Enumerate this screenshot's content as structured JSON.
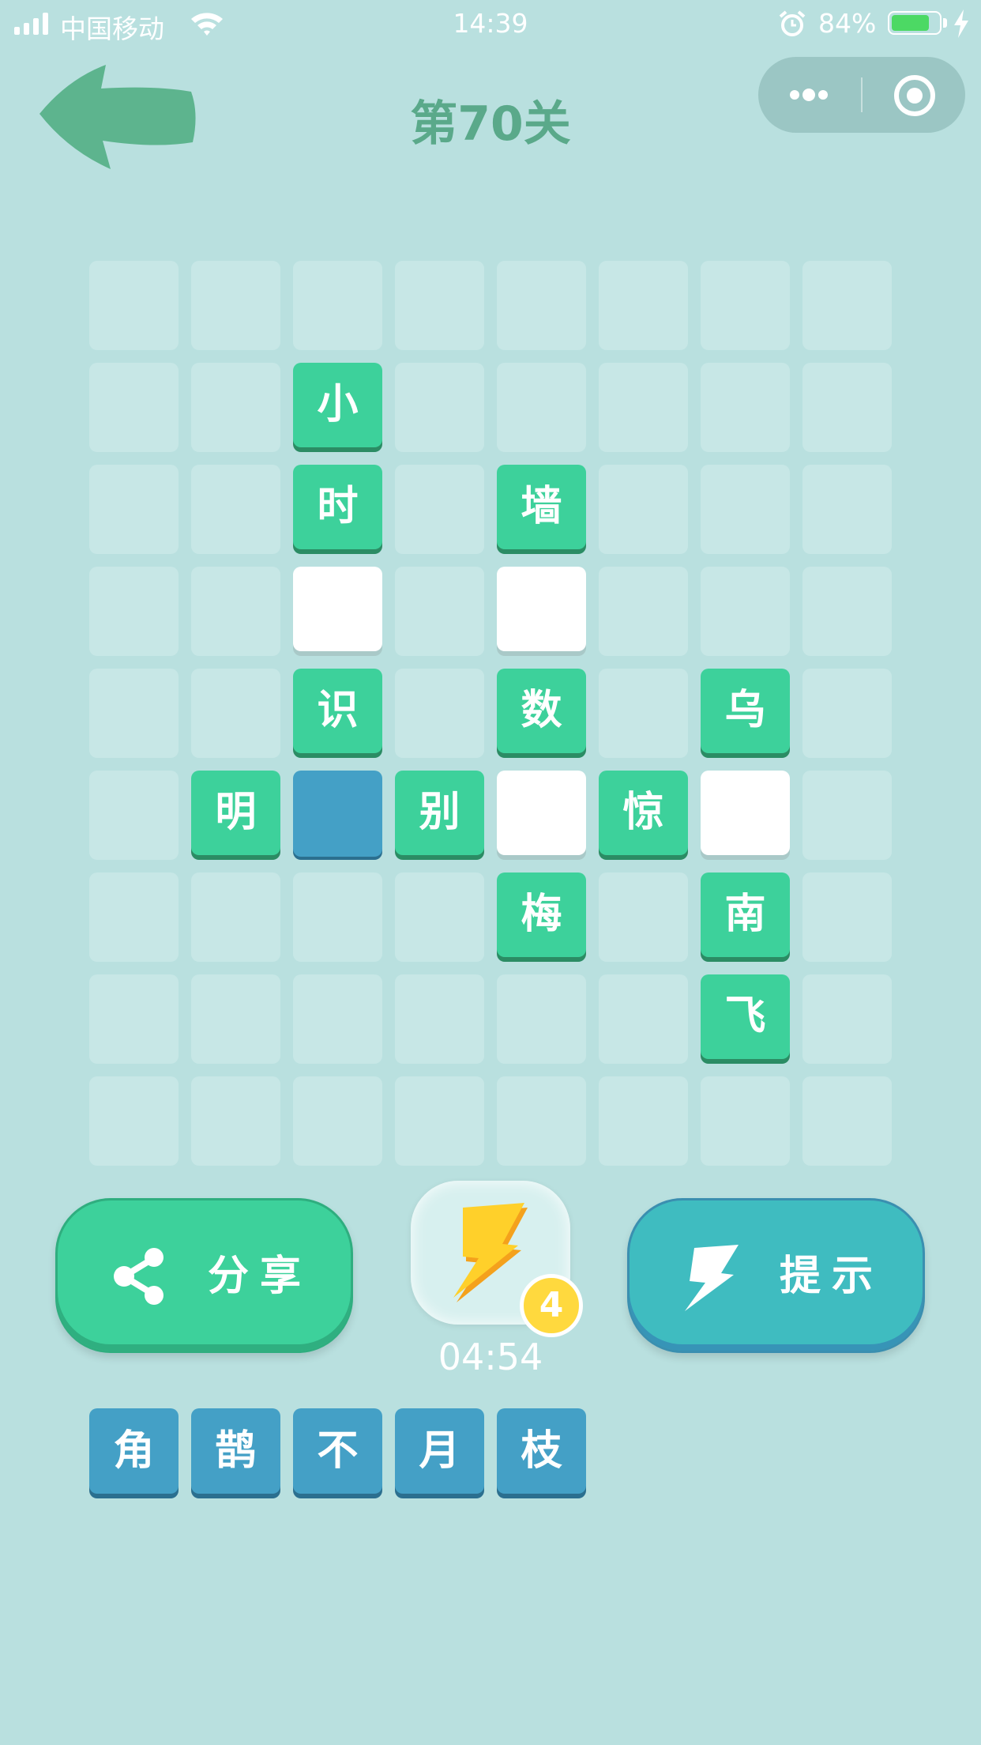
{
  "status_bar": {
    "carrier": "中国移动",
    "time": "14:39",
    "battery_percent": "84%",
    "battery_level": 0.84
  },
  "header": {
    "title": "第70关",
    "back_icon": "arrow-left-icon",
    "more_icon": "more-dots-icon",
    "close_icon": "target-close-icon"
  },
  "board": {
    "cols": 8,
    "rows": 9,
    "cells": [
      {
        "col": 2,
        "row": 1,
        "type": "char",
        "text": "小"
      },
      {
        "col": 2,
        "row": 2,
        "type": "char",
        "text": "时"
      },
      {
        "col": 4,
        "row": 2,
        "type": "char",
        "text": "墙"
      },
      {
        "col": 2,
        "row": 3,
        "type": "blank",
        "text": ""
      },
      {
        "col": 4,
        "row": 3,
        "type": "blank",
        "text": ""
      },
      {
        "col": 2,
        "row": 4,
        "type": "char",
        "text": "识"
      },
      {
        "col": 4,
        "row": 4,
        "type": "char",
        "text": "数"
      },
      {
        "col": 6,
        "row": 4,
        "type": "char",
        "text": "乌"
      },
      {
        "col": 1,
        "row": 5,
        "type": "char",
        "text": "明"
      },
      {
        "col": 2,
        "row": 5,
        "type": "active",
        "text": ""
      },
      {
        "col": 3,
        "row": 5,
        "type": "char",
        "text": "别"
      },
      {
        "col": 4,
        "row": 5,
        "type": "blank",
        "text": ""
      },
      {
        "col": 5,
        "row": 5,
        "type": "char",
        "text": "惊"
      },
      {
        "col": 6,
        "row": 5,
        "type": "blank",
        "text": ""
      },
      {
        "col": 4,
        "row": 6,
        "type": "char",
        "text": "梅"
      },
      {
        "col": 6,
        "row": 6,
        "type": "char",
        "text": "南"
      },
      {
        "col": 6,
        "row": 7,
        "type": "char",
        "text": "飞"
      }
    ]
  },
  "actions": {
    "share_label": "分享",
    "hint_label": "提示",
    "power_count": "4",
    "timer": "04:54"
  },
  "candidates": [
    "角",
    "鹊",
    "不",
    "月",
    "枝"
  ],
  "colors": {
    "background": "#b9e0df",
    "filled_cell": "#3dd19b",
    "active_cell": "#44a0c6",
    "title": "#5aa98a",
    "badge": "#ffd93e"
  }
}
